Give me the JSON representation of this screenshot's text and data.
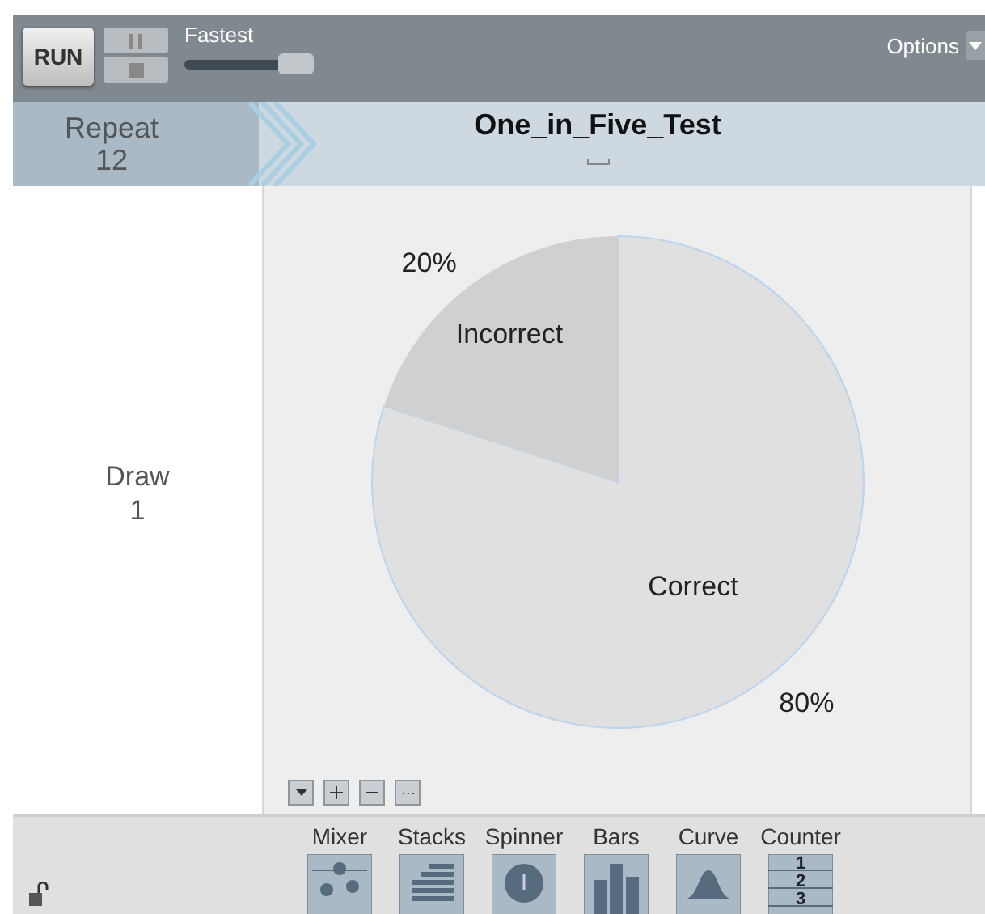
{
  "toolbar": {
    "run_label": "RUN",
    "speed": {
      "label": "Fastest",
      "level": 0.85
    },
    "options_label": "Options"
  },
  "header": {
    "repeat_label": "Repeat",
    "repeat_count": "12",
    "title": "One_in_Five_Test"
  },
  "draw": {
    "label": "Draw",
    "count": "1"
  },
  "chart_data": {
    "type": "pie",
    "categories": [
      "Correct",
      "Incorrect"
    ],
    "values": [
      80,
      20
    ],
    "value_labels": [
      "80%",
      "20%"
    ]
  },
  "tools": [
    {
      "kind": "mixer",
      "label": "Mixer"
    },
    {
      "kind": "stacks",
      "label": "Stacks"
    },
    {
      "kind": "spinner",
      "label": "Spinner"
    },
    {
      "kind": "bars",
      "label": "Bars"
    },
    {
      "kind": "curve",
      "label": "Curve"
    },
    {
      "kind": "counter",
      "label": "Counter",
      "digits": [
        "1",
        "2",
        "3"
      ]
    }
  ],
  "locked": false
}
